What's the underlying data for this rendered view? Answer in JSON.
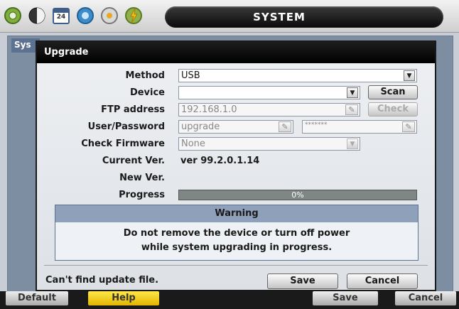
{
  "header": {
    "title": "SYSTEM",
    "icons": [
      "gear-icon",
      "display-icon",
      "calendar-icon",
      "record-icon",
      "disk-icon",
      "alarm-icon"
    ],
    "calendar_day": "24"
  },
  "background": {
    "tab_label": "Sys",
    "buttons": {
      "default": "Default",
      "help": "Help",
      "save": "Save",
      "cancel": "Cancel"
    }
  },
  "dialog": {
    "title": "Upgrade",
    "labels": {
      "method": "Method",
      "device": "Device",
      "ftp": "FTP address",
      "user": "User/Password",
      "check_fw": "Check Firmware",
      "current": "Current Ver.",
      "new": "New Ver.",
      "progress": "Progress"
    },
    "method_value": "USB",
    "device_value": "",
    "scan_label": "Scan",
    "ftp_value": "192.168.1.0",
    "check_label": "Check",
    "user_value": "upgrade",
    "password_value": "*******",
    "check_fw_value": "None",
    "current_version": "ver 99.2.0.1.14",
    "new_version": "",
    "progress_text": "0%",
    "progress_fraction": 0.0,
    "warning": {
      "title": "Warning",
      "line1": "Do not remove the device or turn off power",
      "line2": "while system upgrading in progress."
    },
    "status_text": "Can't find update file.",
    "save_label": "Save",
    "cancel_label": "Cancel"
  },
  "colors": {
    "accent": "#8ea0ba",
    "title_bar": "#000000",
    "panel": "#7d8ea3"
  }
}
